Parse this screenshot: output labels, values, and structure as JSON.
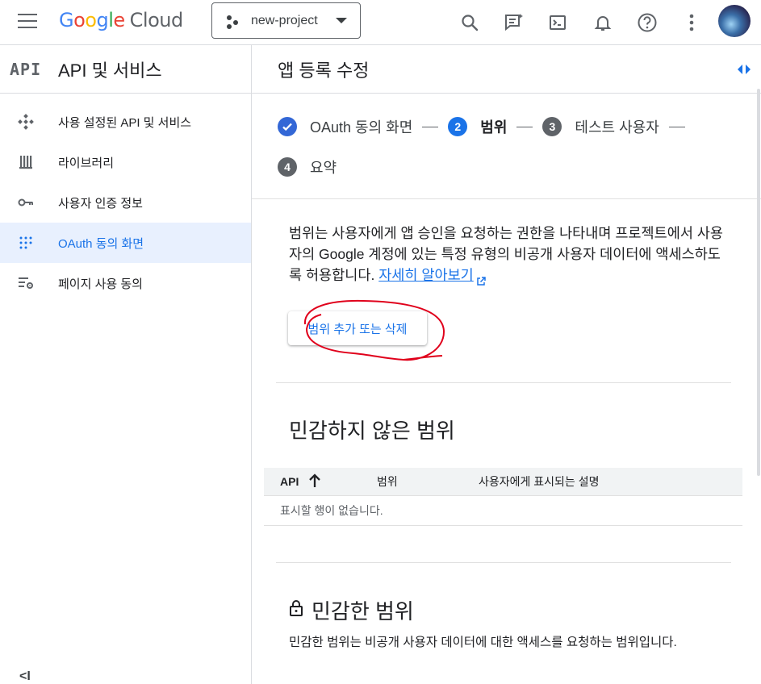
{
  "topbar": {
    "logo_google": [
      "G",
      "o",
      "o",
      "g",
      "l",
      "e"
    ],
    "logo_cloud": "Cloud",
    "project_name": "new-project"
  },
  "sidebar": {
    "logo": "API",
    "title": "API 및 서비스",
    "items": [
      {
        "label": "사용 설정된 API 및 서비스",
        "icon": "diamond-nodes-icon"
      },
      {
        "label": "라이브러리",
        "icon": "library-icon"
      },
      {
        "label": "사용자 인증 정보",
        "icon": "key-icon"
      },
      {
        "label": "OAuth 동의 화면",
        "icon": "oauth-dots-icon",
        "active": true
      },
      {
        "label": "페이지 사용 동의",
        "icon": "settings-list-icon"
      }
    ],
    "collapse": "<I"
  },
  "main": {
    "title": "앱 등록 수정",
    "steps": [
      {
        "number": "",
        "label": "OAuth 동의 화면",
        "state": "done"
      },
      {
        "number": "2",
        "label": "범위",
        "state": "current"
      },
      {
        "number": "3",
        "label": "테스트 사용자",
        "state": "pending"
      },
      {
        "number": "4",
        "label": "요약",
        "state": "pending"
      }
    ],
    "description": "범위는 사용자에게 앱 승인을 요청하는 권한을 나타내며 프로젝트에서 사용자의 Google 계정에 있는 특정 유형의 비공개 사용자 데이터에 액세스하도록 허용합니다.",
    "learn_more": "자세히 알아보기",
    "scope_button": "범위 추가 또는 삭제",
    "non_sensitive_title": "민감하지 않은 범위",
    "table": {
      "headers": [
        "API",
        "범위",
        "사용자에게 표시되는 설명"
      ],
      "empty": "표시할 행이 없습니다."
    },
    "sensitive_title": "민감한 범위",
    "sensitive_desc": "민감한 범위는 비공개 사용자 데이터에 대한 액세스를 요청하는 범위입니다."
  },
  "colors": {
    "accent": "#1a73e8",
    "annotation": "#e0001b"
  }
}
